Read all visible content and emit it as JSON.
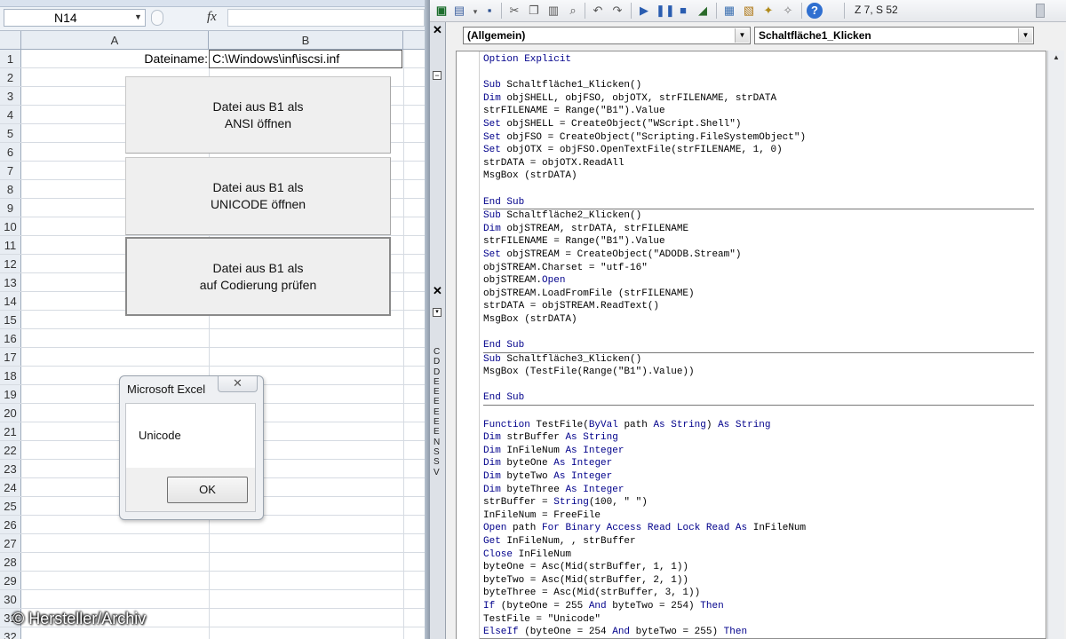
{
  "excel": {
    "name_box": "N14",
    "fx_label": "fx",
    "columns": [
      "A",
      "B"
    ],
    "rows": [
      "1",
      "2",
      "3",
      "4",
      "5",
      "6",
      "7",
      "8",
      "9",
      "10",
      "11",
      "12",
      "13",
      "14",
      "15",
      "16",
      "17",
      "18",
      "19",
      "20",
      "21",
      "22",
      "23",
      "24",
      "25",
      "26",
      "27",
      "28",
      "29",
      "30",
      "31",
      "32"
    ],
    "cell_a1": "Dateiname:",
    "cell_b1": "C:\\Windows\\inf\\iscsi.inf",
    "buttons": [
      {
        "line1": "Datei aus B1 als",
        "line2": "ANSI öffnen"
      },
      {
        "line1": "Datei aus B1 als",
        "line2": "UNICODE öffnen"
      },
      {
        "line1": "Datei aus B1 als",
        "line2": "auf Codierung prüfen"
      }
    ],
    "msgbox": {
      "title": "Microsoft Excel",
      "close": "✕",
      "text": "Unicode",
      "ok": "OK"
    }
  },
  "watermark": {
    "symbol": "©",
    "text": "Hersteller/Archiv"
  },
  "vba": {
    "position": "Z 7, S 52",
    "combo_object": "(Allgemein)",
    "combo_procedure": "Schaltfläche1_Klicken",
    "panel_close_1": "✕",
    "panel_close_2": "✕",
    "panel_letters": [
      "C",
      "D",
      "D",
      "E",
      "E",
      "E",
      "E",
      "E",
      "E",
      "N",
      "S",
      "S",
      "V"
    ],
    "code": [
      "Option Explicit",
      "",
      "Sub Schaltfläche1_Klicken()",
      "Dim objSHELL, objFSO, objOTX, strFILENAME, strDATA",
      "strFILENAME = Range(\"B1\").Value",
      "Set objSHELL = CreateObject(\"WScript.Shell\")",
      "Set objFSO = CreateObject(\"Scripting.FileSystemObject\")",
      "Set objOTX = objFSO.OpenTextFile(strFILENAME, 1, 0)",
      "strDATA = objOTX.ReadAll",
      "MsgBox (strDATA)",
      "",
      "End Sub",
      "Sub Schaltfläche2_Klicken()",
      "Dim objSTREAM, strDATA, strFILENAME",
      "strFILENAME = Range(\"B1\").Value",
      "Set objSTREAM = CreateObject(\"ADODB.Stream\")",
      "objSTREAM.Charset = \"utf-16\"",
      "objSTREAM.Open",
      "objSTREAM.LoadFromFile (strFILENAME)",
      "strDATA = objSTREAM.ReadText()",
      "MsgBox (strDATA)",
      "",
      "End Sub",
      "Sub Schaltfläche3_Klicken()",
      "MsgBox (TestFile(Range(\"B1\").Value))",
      "",
      "End Sub",
      "",
      "Function TestFile(ByVal path As String) As String",
      "Dim strBuffer As String",
      "Dim InFileNum As Integer",
      "Dim byteOne As Integer",
      "Dim byteTwo As Integer",
      "Dim byteThree As Integer",
      "strBuffer = String(100, \" \")",
      "InFileNum = FreeFile",
      "Open path For Binary Access Read Lock Read As InFileNum",
      "Get InFileNum, , strBuffer",
      "Close InFileNum",
      "byteOne = Asc(Mid(strBuffer, 1, 1))",
      "byteTwo = Asc(Mid(strBuffer, 2, 1))",
      "byteThree = Asc(Mid(strBuffer, 3, 1))",
      "If (byteOne = 255 And byteTwo = 254) Then",
      "TestFile = \"Unicode\"",
      "ElseIf (byteOne = 254 And byteTwo = 255) Then"
    ]
  }
}
